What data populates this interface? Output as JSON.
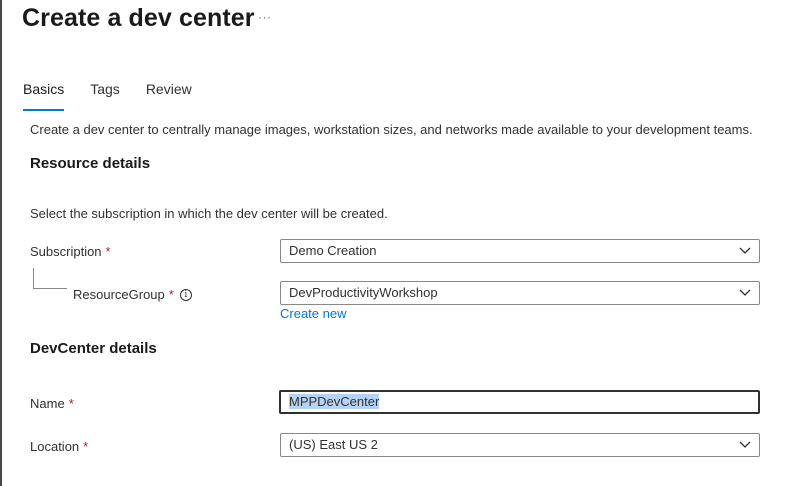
{
  "page": {
    "title": "Create a dev center",
    "more_icon": "ellipsis-icon"
  },
  "tabs": [
    {
      "label": "Basics",
      "active": true
    },
    {
      "label": "Tags",
      "active": false
    },
    {
      "label": "Review",
      "active": false
    }
  ],
  "intro": "Create a dev center to centrally manage images, workstation sizes, and networks made available to your development teams.",
  "resource_details": {
    "heading": "Resource details",
    "subtitle": "Select the subscription in which the dev center will be created.",
    "subscription": {
      "label": "Subscription",
      "required": "*",
      "value": "Demo Creation"
    },
    "resource_group": {
      "label": "ResourceGroup",
      "required": "*",
      "info_icon": "i",
      "value": "DevProductivityWorkshop"
    },
    "create_new": "Create new"
  },
  "devcenter_details": {
    "heading": "DevCenter details",
    "name": {
      "label": "Name",
      "required": "*",
      "value": "MPPDevCenter"
    },
    "location": {
      "label": "Location",
      "required": "*",
      "value": "(US) East US 2"
    }
  },
  "colors": {
    "accent": "#0078d4",
    "required": "#a4262c",
    "selection": "#b4d3f5"
  }
}
